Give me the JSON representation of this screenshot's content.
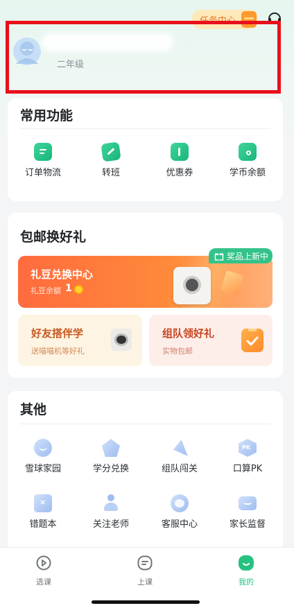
{
  "header": {
    "task_center": "任务中心",
    "grade": "二年级"
  },
  "common": {
    "title": "常用功能",
    "items": [
      {
        "label": "订单物流",
        "icon": "order-icon"
      },
      {
        "label": "转班",
        "icon": "transfer-icon"
      },
      {
        "label": "优惠券",
        "icon": "coupon-icon"
      },
      {
        "label": "学币余额",
        "icon": "wallet-icon"
      }
    ]
  },
  "gifts": {
    "title": "包邮换好礼",
    "new_tag": "奖品上新中",
    "exchange_title": "礼豆兑换中心",
    "balance_label": "礼豆余额",
    "balance_value": "1",
    "friend_title": "好友搭伴学",
    "friend_sub": "送喵喵机等好礼",
    "team_title": "组队领好礼",
    "team_sub": "实物包邮"
  },
  "others": {
    "title": "其他",
    "items": [
      {
        "label": "雪球家园",
        "icon": "snowball-icon"
      },
      {
        "label": "学分兑换",
        "icon": "credit-icon"
      },
      {
        "label": "组队闯关",
        "icon": "team-icon"
      },
      {
        "label": "口算PK",
        "icon": "pk-icon"
      },
      {
        "label": "错题本",
        "icon": "mistake-book-icon"
      },
      {
        "label": "关注老师",
        "icon": "teacher-icon"
      },
      {
        "label": "客服中心",
        "icon": "service-icon"
      },
      {
        "label": "家长监督",
        "icon": "monitor-icon"
      }
    ]
  },
  "tabbar": {
    "items": [
      {
        "label": "选课"
      },
      {
        "label": "上课"
      },
      {
        "label": "我的"
      }
    ],
    "active_color": "#26c281",
    "inactive_color": "#6f7478"
  }
}
